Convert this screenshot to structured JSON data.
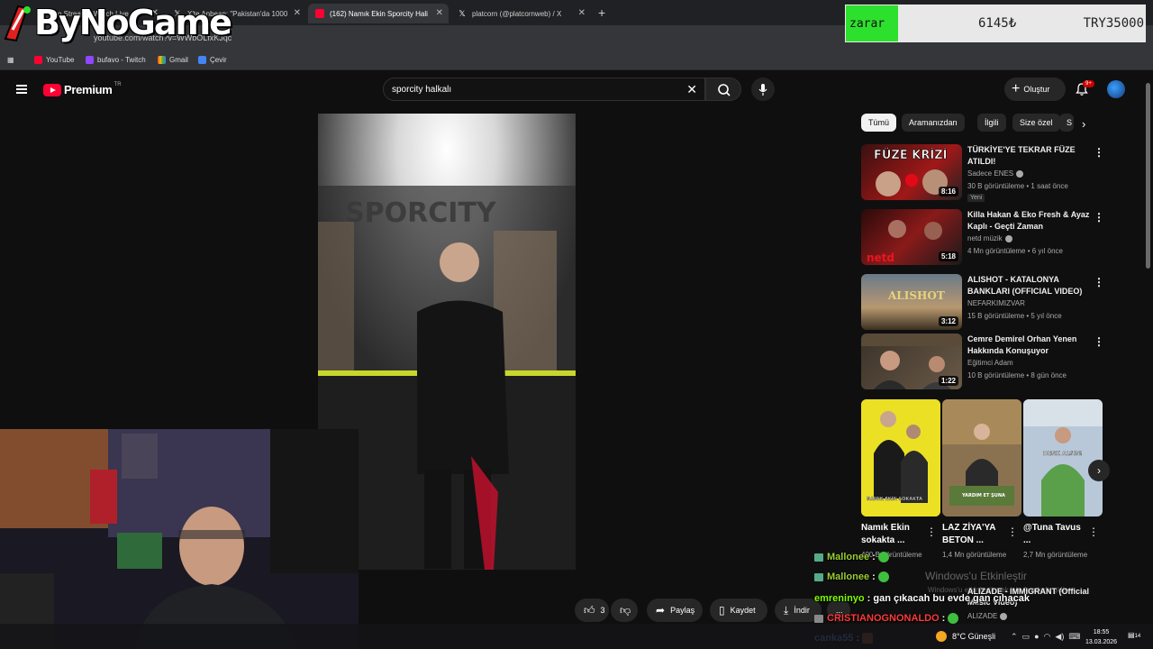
{
  "browser": {
    "tabs": [
      {
        "label": "o Stream - Watch Live",
        "active": false
      },
      {
        "label": "X'te Anbean: \"Pakistan'da 1000",
        "active": false
      },
      {
        "label": "(162) Namık Ekin Sporcity Hali",
        "active": true
      },
      {
        "label": "platcorn (@platcornweb) / X",
        "active": false
      }
    ],
    "url": "youtube.com/watch?v=WWbOLfxKJqc",
    "bookmarks": [
      "YouTube",
      "bufavo - Twitch",
      "Gmail",
      "Çevir"
    ]
  },
  "overlay": {
    "brand": "ByNoGame",
    "zarar_label": "zarar",
    "zarar_value": "6145₺",
    "zarar_target": "TRY35000"
  },
  "youtube": {
    "logo_text": "Premium",
    "logo_region": "TR",
    "search_query": "sporcity halkalı",
    "create_label": "Oluştur",
    "notif_badge": "9+",
    "chips": [
      "Tümü",
      "Aramanızdan",
      "İlgili",
      "Size özel",
      "S"
    ],
    "actions": {
      "like_count": "3",
      "share": "Paylaş",
      "save": "Kaydet",
      "download": "İndir",
      "more": "..."
    },
    "recommendations": [
      {
        "title": "TÜRKİYE'YE TEKRAR FÜZE ATILDI!",
        "channel": "Sadece ENES",
        "meta": "30 B görüntüleme • 1 saat önce",
        "badge": "Yeni",
        "duration": "8:16",
        "thumb_text": "FÜZE KRİZİ"
      },
      {
        "title": "Killa Hakan & Eko Fresh & Ayaz Kaplı - Geçti Zaman",
        "channel": "netd müzik",
        "meta": "4 Mn görüntüleme • 6 yıl önce",
        "badge": "",
        "duration": "5:18",
        "thumb_text": "netd"
      },
      {
        "title": "ALISHOT - KATALONYA BANKLARI (OFFICIAL VIDEO)",
        "channel": "NEFARKIMIZVAR",
        "meta": "15 B görüntüleme • 5 yıl önce",
        "badge": "",
        "duration": "3:12",
        "thumb_text": "ALISHOT"
      },
      {
        "title": "Cemre Demirel Orhan Yenen Hakkında Konuşuyor",
        "channel": "Eğitimci Adam",
        "meta": "10 B görüntüleme • 8 gün önce",
        "badge": "",
        "duration": "1:22",
        "thumb_text": ""
      }
    ],
    "shorts": [
      {
        "title": "Namık Ekin sokakta ...",
        "views": "400 B görüntüleme",
        "thumb_text": "NAMIK EKİN SOKAKTA"
      },
      {
        "title": "LAZ ZİYA'YA BETON ...",
        "views": "1,4 Mn görüntüleme",
        "thumb_text": "YARDIM ET ŞUNA"
      },
      {
        "title": "@Tuna Tavus ...",
        "views": "2,7 Mn görüntüleme",
        "thumb_text": "DENK ALSIN!"
      }
    ]
  },
  "chat": [
    {
      "user": "Mallonee",
      "msg": ":",
      "color": "#9acd32"
    },
    {
      "user": "Mallonee",
      "msg": ":",
      "color": "#9acd32"
    },
    {
      "user": "emreninyo",
      "msg": ": gan çıkacah bu evde gan çıhacak",
      "color": "#7fff00"
    },
    {
      "user": "CRISTIANOGNONALDO",
      "msg": ":",
      "color": "#ff3b3b"
    },
    {
      "user": "canka55",
      "msg": ":",
      "color": "#6aa0ff"
    }
  ],
  "partial_video": {
    "title": "ALIZADE - IMMIGRANT (Official Music Video)",
    "channel": "ALIZADE"
  },
  "windows": {
    "activate": "Windows'u Etkinleştir",
    "activate_sub": "Windows'u etkinleştirmek için Ayarlar'a gidin.",
    "weather": "8°C Güneşli",
    "time": "18:55",
    "date": "13.03.2026",
    "notifications": "14"
  },
  "colors": {
    "youtube_red": "#ff0033",
    "zarar_green": "#2ee02e",
    "background": "#0f0f0f"
  }
}
